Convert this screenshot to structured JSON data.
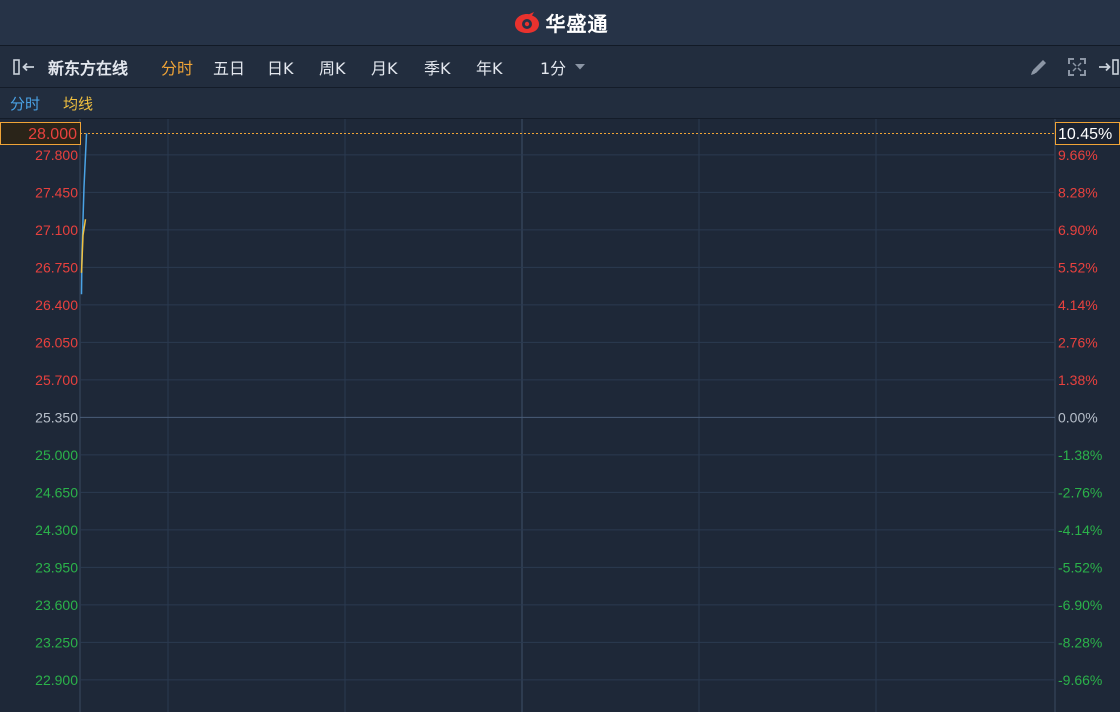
{
  "header": {
    "brand_name": "华盛通",
    "logo_icon": "huashengtong-logo-icon"
  },
  "toolbar": {
    "stock_name": "新东方在线",
    "tabs": [
      {
        "label": "分时",
        "active": true
      },
      {
        "label": "五日",
        "active": false
      },
      {
        "label": "日K",
        "active": false
      },
      {
        "label": "周K",
        "active": false
      },
      {
        "label": "月K",
        "active": false
      },
      {
        "label": "季K",
        "active": false
      },
      {
        "label": "年K",
        "active": false
      }
    ],
    "interval": {
      "selected": "1分"
    },
    "icons": [
      "collapse-left-icon",
      "edit-pencil-icon",
      "fullscreen-icon",
      "exit-panel-icon"
    ]
  },
  "legend": {
    "line_label": "分时",
    "avg_label": "均线",
    "line_color": "#4aa3e6",
    "avg_color": "#f0c040"
  },
  "colors": {
    "up": "#e8413e",
    "down": "#2bb24a",
    "neutral": "#b6bec9",
    "accent": "#f0a437",
    "background": "#1e2838"
  },
  "chart_data": {
    "type": "line",
    "prev_close": 25.35,
    "current_price": "28.000",
    "current_pct": "10.45%",
    "ylim": [
      22.9,
      28.0
    ],
    "y_ticks": [
      "27.800",
      "27.450",
      "27.100",
      "26.750",
      "26.400",
      "26.050",
      "25.700",
      "25.350",
      "25.000",
      "24.650",
      "24.300",
      "23.950",
      "23.600",
      "23.250",
      "22.900"
    ],
    "pct_ticks": [
      "9.66%",
      "8.28%",
      "6.90%",
      "5.52%",
      "4.14%",
      "2.76%",
      "1.38%",
      "0.00%",
      "-1.38%",
      "-2.76%",
      "-4.14%",
      "-5.52%",
      "-6.90%",
      "-8.28%",
      "-9.66%"
    ],
    "series": [
      {
        "values": [
          26.5,
          26.9,
          27.5,
          28.0
        ]
      },
      {
        "values": [
          26.7,
          27.05,
          27.2
        ]
      }
    ]
  }
}
